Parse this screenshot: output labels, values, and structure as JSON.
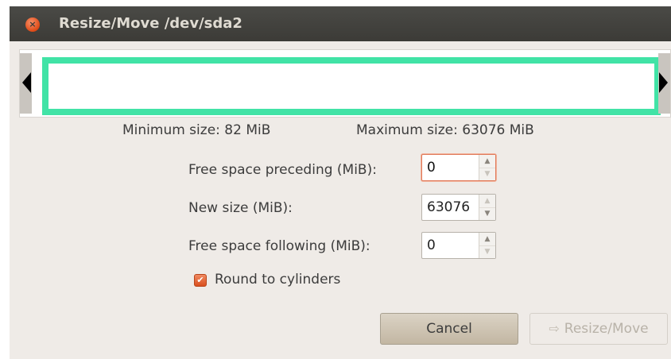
{
  "window": {
    "title": "Resize/Move /dev/sda2",
    "close_icon": "close-icon",
    "close_glyph": "×"
  },
  "partition": {
    "bar_color": "#41e3a6"
  },
  "sizes": {
    "minimum": "Minimum size: 82 MiB",
    "maximum": "Maximum size: 63076 MiB"
  },
  "fields": {
    "preceding": {
      "label": "Free space preceding (MiB):",
      "value": "0"
    },
    "new_size": {
      "label": "New size (MiB):",
      "value": "63076"
    },
    "following": {
      "label": "Free space following (MiB):",
      "value": "0"
    }
  },
  "spin": {
    "up": "▲",
    "down": "▼"
  },
  "options": {
    "round_label": "Round to cylinders",
    "round_checked": true,
    "check_glyph": "✔"
  },
  "buttons": {
    "cancel": "Cancel",
    "resize": "Resize/Move",
    "resize_icon_glyph": "⇨"
  }
}
